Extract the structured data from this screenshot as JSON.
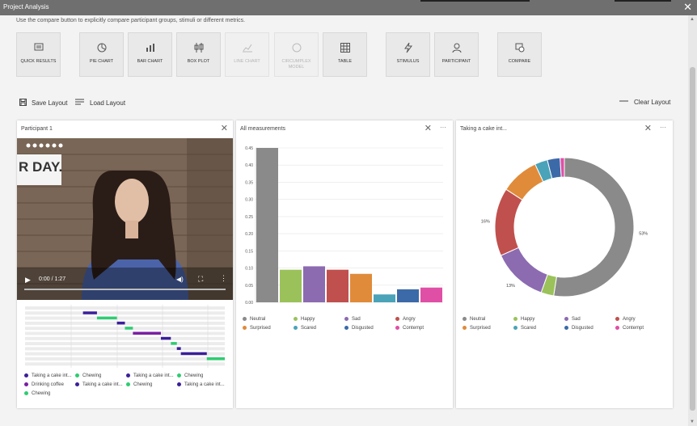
{
  "window": {
    "title": "Project Analysis"
  },
  "help_text": "Use the compare button to explicitly compare participant groups, stimuli or different metrics.",
  "toolbar": [
    {
      "label": "QUICK RESULTS",
      "icon": "quick-results-icon",
      "enabled": true
    },
    {
      "label": "PIE CHART",
      "icon": "pie-chart-icon",
      "enabled": true
    },
    {
      "label": "BAR CHART",
      "icon": "bar-chart-icon",
      "enabled": true
    },
    {
      "label": "BOX PLOT",
      "icon": "box-plot-icon",
      "enabled": true
    },
    {
      "label": "LINE CHART",
      "icon": "line-chart-icon",
      "enabled": false
    },
    {
      "label": "CIRCUMPLEX MODEL",
      "icon": "circumplex-icon",
      "enabled": false
    },
    {
      "label": "TABLE",
      "icon": "table-icon",
      "enabled": true
    },
    {
      "label": "STIMULUS",
      "icon": "stimulus-icon",
      "enabled": true
    },
    {
      "label": "PARTICIPANT",
      "icon": "participant-icon",
      "enabled": true
    },
    {
      "label": "COMPARE",
      "icon": "compare-icon",
      "enabled": true
    }
  ],
  "layout": {
    "save_label": "Save Layout",
    "load_label": "Load Layout",
    "clear_label": "Clear Layout"
  },
  "participant_panel": {
    "title": "Participant 1",
    "video_overlay_text": "R DAY.",
    "time": "0:00 / 1:27",
    "legend": [
      {
        "label": "Taking a cake int...",
        "color": "#3b1f99"
      },
      {
        "label": "Chewing",
        "color": "#2ecc71"
      },
      {
        "label": "Taking a cake int...",
        "color": "#3b1f99"
      },
      {
        "label": "Chewing",
        "color": "#2ecc71"
      },
      {
        "label": "Drinking coffee",
        "color": "#7a1fa2"
      },
      {
        "label": "Taking a cake int...",
        "color": "#3b1f99"
      },
      {
        "label": "Chewing",
        "color": "#2ecc71"
      },
      {
        "label": "Taking a cake int...",
        "color": "#3b1f99"
      },
      {
        "label": "Chewing",
        "color": "#2ecc71"
      }
    ]
  },
  "bar_panel": {
    "title": "All measurements"
  },
  "pie_panel": {
    "title": "Taking a cake int..."
  },
  "emotions": [
    {
      "label": "Neutral",
      "color": "#8a8a8a"
    },
    {
      "label": "Happy",
      "color": "#9bc25a"
    },
    {
      "label": "Sad",
      "color": "#8c6bb1"
    },
    {
      "label": "Angry",
      "color": "#c0504d"
    },
    {
      "label": "Surprised",
      "color": "#e08b3a"
    },
    {
      "label": "Scared",
      "color": "#4aa3b8"
    },
    {
      "label": "Disgusted",
      "color": "#3c6aa8"
    },
    {
      "label": "Contempt",
      "color": "#e04fa6"
    }
  ],
  "chart_data": [
    {
      "type": "bar",
      "title": "All measurements",
      "categories": [
        "Neutral",
        "Happy",
        "Sad",
        "Angry",
        "Surprised",
        "Scared",
        "Disgusted",
        "Contempt"
      ],
      "values": [
        0.45,
        0.095,
        0.105,
        0.095,
        0.083,
        0.023,
        0.038,
        0.043
      ],
      "yticks": [
        "0.00",
        "0.05",
        "0.10",
        "0.15",
        "0.20",
        "0.25",
        "0.30",
        "0.35",
        "0.40",
        "0.45"
      ],
      "ylim": [
        0,
        0.45
      ],
      "grid": true
    },
    {
      "type": "pie",
      "title": "Taking a cake int...",
      "categories": [
        "Neutral",
        "Happy",
        "Sad",
        "Angry",
        "Surprised",
        "Scared",
        "Disgusted",
        "Contempt"
      ],
      "values": [
        53,
        3,
        13,
        16,
        9,
        3,
        3,
        1
      ],
      "data_labels": [
        "53%",
        "",
        "13%",
        "16%",
        "",
        "",
        "",
        ""
      ]
    }
  ]
}
